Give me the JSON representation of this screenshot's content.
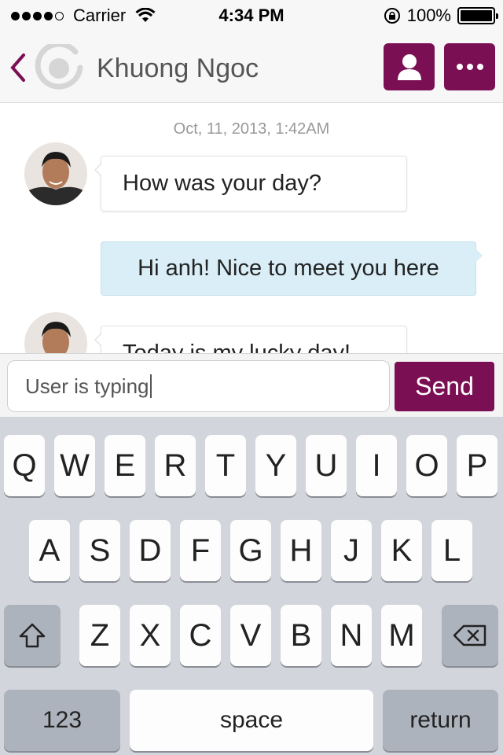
{
  "status_bar": {
    "carrier": "Carrier",
    "time": "4:34 PM",
    "battery": "100%",
    "battery_level": 1.0,
    "signal_bars_filled": 4,
    "signal_bars_total": 5
  },
  "nav": {
    "contact_name": "Khuong Ngoc",
    "accent_color": "#7b0f53",
    "icons": [
      "back-chevron-icon",
      "app-logo-icon",
      "person-icon",
      "more-dots-icon"
    ]
  },
  "chat": {
    "timestamp": "Oct, 11, 2013, 1:42AM",
    "messages": [
      {
        "direction": "incoming",
        "text": "How was your day?"
      },
      {
        "direction": "outgoing",
        "text": "Hi anh! Nice to meet you here"
      },
      {
        "direction": "incoming",
        "text": "Today is my lucky day!"
      }
    ]
  },
  "composer": {
    "value": "User is typing",
    "send_label": "Send"
  },
  "keyboard": {
    "row1": [
      "Q",
      "W",
      "E",
      "R",
      "T",
      "Y",
      "U",
      "I",
      "O",
      "P"
    ],
    "row2": [
      "A",
      "S",
      "D",
      "F",
      "G",
      "H",
      "J",
      "K",
      "L"
    ],
    "row3": [
      "Z",
      "X",
      "C",
      "V",
      "B",
      "N",
      "M"
    ],
    "numbers_label": "123",
    "space_label": "space",
    "return_label": "return"
  }
}
